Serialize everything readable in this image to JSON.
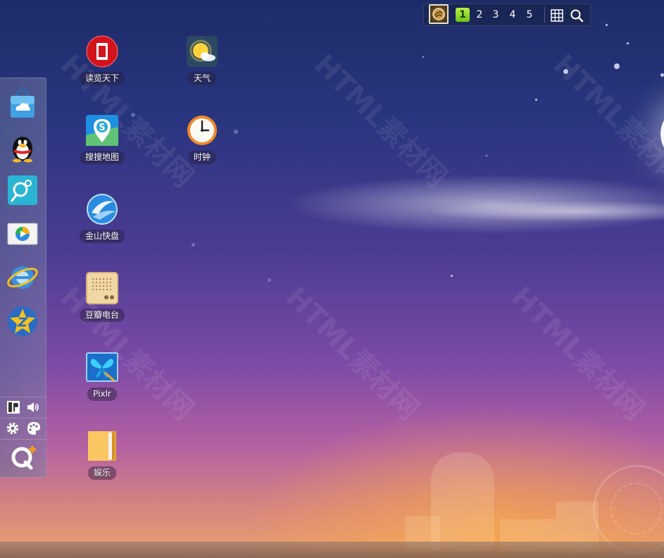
{
  "desktop": {
    "apps": [
      {
        "id": "read",
        "label": "读览天下",
        "icon": "red-book-icon"
      },
      {
        "id": "weather",
        "label": "天气",
        "icon": "weather-sun-icon"
      },
      {
        "id": "sogou-map",
        "label": "搜搜地图",
        "icon": "map-pin-icon"
      },
      {
        "id": "clock",
        "label": "时钟",
        "icon": "clock-icon"
      },
      {
        "id": "kuaipan",
        "label": "金山快盘",
        "icon": "cloud-disk-icon"
      },
      {
        "id": "douban",
        "label": "豆瓣电台",
        "icon": "radio-icon"
      },
      {
        "id": "pixlr",
        "label": "Pixlr",
        "icon": "butterfly-icon"
      },
      {
        "id": "entertainment",
        "label": "娱乐",
        "icon": "folder-icon"
      }
    ]
  },
  "pager": {
    "pages": [
      "1",
      "2",
      "3",
      "4",
      "5"
    ],
    "active_page": "1",
    "tools": [
      "grid-view-icon",
      "search-icon"
    ]
  },
  "dock": {
    "apps": [
      "app-store-icon",
      "qq-penguin-icon",
      "qq-browser-icon",
      "tencent-video-icon",
      "internet-explorer-icon",
      "qzone-star-icon"
    ],
    "tools": [
      "ime-icon",
      "volume-icon",
      "settings-icon",
      "theme-palette-icon",
      "qplus-logo-icon"
    ]
  },
  "colors": {
    "active_page": "#8fdc2a",
    "label_bg": "#2e2240"
  }
}
